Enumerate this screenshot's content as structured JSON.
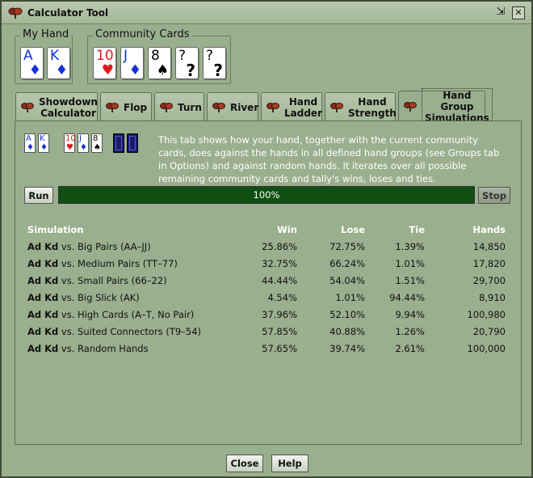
{
  "window": {
    "title": "Calculator Tool",
    "minimize_glyph": "⇲",
    "close_glyph": "✕"
  },
  "my_hand": {
    "label": "My Hand",
    "cards": [
      {
        "rank": "A",
        "suit": "♦",
        "color": "#1530d8"
      },
      {
        "rank": "K",
        "suit": "♦",
        "color": "#1530d8"
      }
    ]
  },
  "community": {
    "label": "Community Cards",
    "cards": [
      {
        "rank": "10",
        "suit": "♥",
        "color": "#e01818"
      },
      {
        "rank": "J",
        "suit": "♦",
        "color": "#1530d8"
      },
      {
        "rank": "8",
        "suit": "♠",
        "color": "#000000"
      },
      {
        "rank": "?",
        "suit": "?",
        "color": "#000000"
      },
      {
        "rank": "?",
        "suit": "?",
        "color": "#000000"
      }
    ]
  },
  "tabs": [
    {
      "label_line1": "Showdown",
      "label_line2": "Calculator",
      "icon": "poker-chips-icon"
    },
    {
      "label_line1": "Flop",
      "label_line2": "",
      "icon": "poker-chips-icon"
    },
    {
      "label_line1": "Turn",
      "label_line2": "",
      "icon": "poker-chips-icon"
    },
    {
      "label_line1": "River",
      "label_line2": "",
      "icon": "poker-chips-icon"
    },
    {
      "label_line1": "Hand",
      "label_line2": "Ladder",
      "icon": "poker-chips-icon"
    },
    {
      "label_line1": "Hand",
      "label_line2": "Strength",
      "icon": "poker-chips-icon"
    },
    {
      "label_line1": "Hand Group",
      "label_line2": "Simulations",
      "icon": "poker-chips-icon"
    }
  ],
  "active_tab": 6,
  "mini_hand": [
    {
      "rank": "A",
      "suit": "♦",
      "color": "#1530d8"
    },
    {
      "rank": "K",
      "suit": "♦",
      "color": "#1530d8"
    }
  ],
  "mini_board": [
    {
      "rank": "10",
      "suit": "♥",
      "color": "#e01818"
    },
    {
      "rank": "J",
      "suit": "♦",
      "color": "#1530d8"
    },
    {
      "rank": "8",
      "suit": "♠",
      "color": "#000000"
    }
  ],
  "description": "This tab shows how your hand, together with the current community cards, does against the hands in all defined hand groups (see Groups tab in Options) and against random hands. It iterates over all possible remaining community cards and tally's wins, loses and ties.",
  "run_label": "Run",
  "stop_label": "Stop",
  "progress": {
    "value": 1.0,
    "text": "100%"
  },
  "table": {
    "headers": {
      "simulation": "Simulation",
      "win": "Win",
      "lose": "Lose",
      "tie": "Tie",
      "hands": "Hands"
    },
    "rows": [
      {
        "hand": "Ad Kd",
        "vs": " vs. Big Pairs (AA–JJ)",
        "win": "25.86%",
        "lose": "72.75%",
        "tie": "1.39%",
        "hands": "14,850"
      },
      {
        "hand": "Ad Kd",
        "vs": " vs. Medium Pairs (TT–77)",
        "win": "32.75%",
        "lose": "66.24%",
        "tie": "1.01%",
        "hands": "17,820"
      },
      {
        "hand": "Ad Kd",
        "vs": " vs. Small Pairs (66–22)",
        "win": "44.44%",
        "lose": "54.04%",
        "tie": "1.51%",
        "hands": "29,700"
      },
      {
        "hand": "Ad Kd",
        "vs": " vs. Big Slick (AK)",
        "win": "4.54%",
        "lose": "1.01%",
        "tie": "94.44%",
        "hands": "8,910"
      },
      {
        "hand": "Ad Kd",
        "vs": " vs. High Cards (A–T, No Pair)",
        "win": "37.96%",
        "lose": "52.10%",
        "tie": "9.94%",
        "hands": "100,980"
      },
      {
        "hand": "Ad Kd",
        "vs": " vs. Suited Connectors (T9–54)",
        "win": "57.85%",
        "lose": "40.88%",
        "tie": "1.26%",
        "hands": "20,790"
      },
      {
        "hand": "Ad Kd",
        "vs": " vs. Random Hands",
        "win": "57.65%",
        "lose": "39.74%",
        "tie": "2.61%",
        "hands": "100,000"
      }
    ]
  },
  "footer": {
    "close_label": "Close",
    "help_label": "Help"
  }
}
